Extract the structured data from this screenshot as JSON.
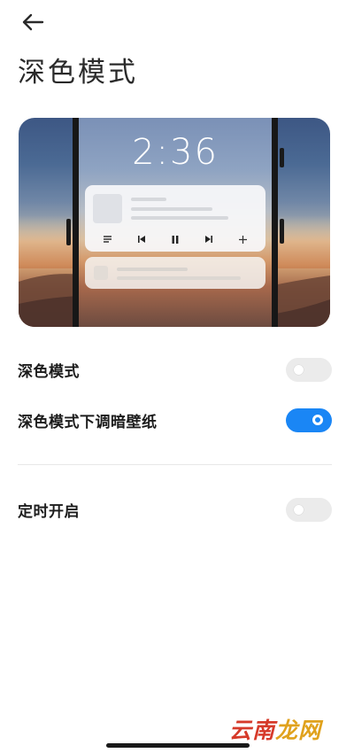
{
  "header": {
    "title": "深色模式"
  },
  "preview": {
    "time": "2:36"
  },
  "settings": [
    {
      "label": "深色模式",
      "enabled": false
    },
    {
      "label": "深色模式下调暗壁纸",
      "enabled": true
    },
    {
      "label": "定时开启",
      "enabled": false
    }
  ],
  "colors": {
    "toggle_on": "#1a86f5",
    "toggle_off": "#ebebeb"
  },
  "watermark": {
    "part1": "云南",
    "part2": "龙网"
  }
}
